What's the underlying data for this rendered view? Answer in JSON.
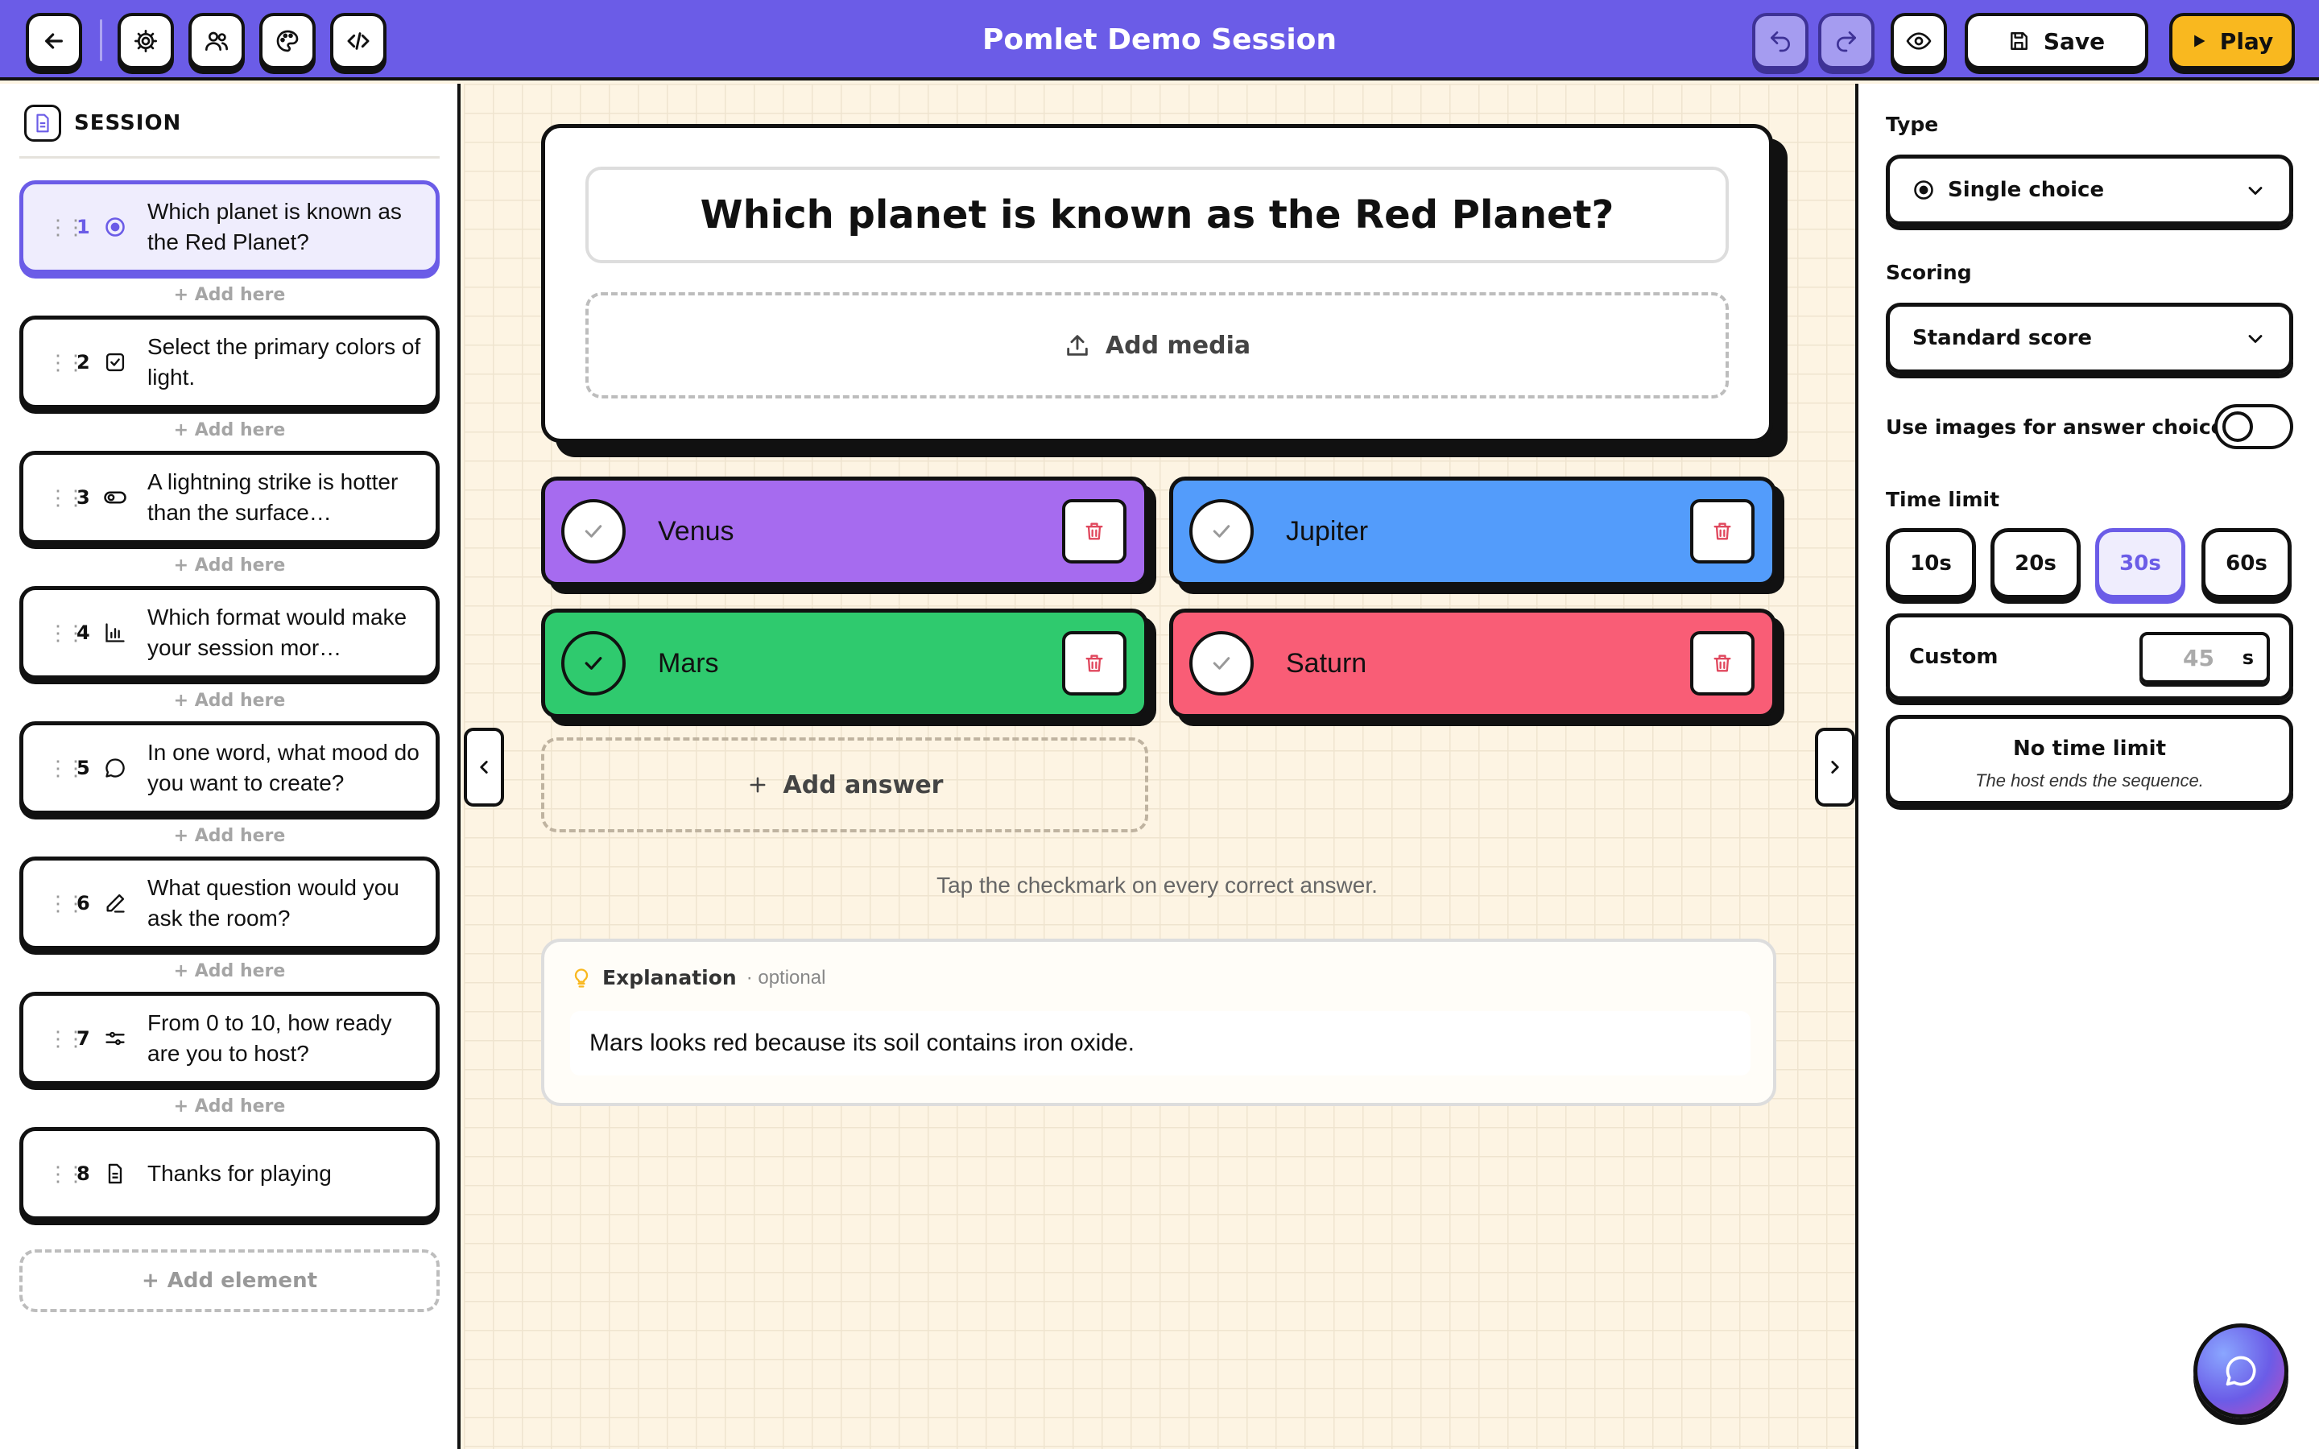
{
  "header": {
    "title": "Pomlet Demo Session",
    "save_label": "Save",
    "play_label": "Play"
  },
  "sidebar": {
    "heading": "SESSION",
    "add_here_label": "+ Add here",
    "add_element_label": "Add element",
    "items": [
      {
        "num": "1",
        "text": "Which planet is known as the Red Planet?",
        "icon": "single-choice-icon"
      },
      {
        "num": "2",
        "text": "Select the primary colors of light.",
        "icon": "multiple-choice-icon"
      },
      {
        "num": "3",
        "text": "A lightning strike is hotter than the surface…",
        "icon": "true-false-toggle-icon"
      },
      {
        "num": "4",
        "text": "Which format would make your session mor…",
        "icon": "poll-chart-icon"
      },
      {
        "num": "5",
        "text": "In one word, what mood do you want to create?",
        "icon": "word-cloud-bubble-icon"
      },
      {
        "num": "6",
        "text": "What question would you ask the room?",
        "icon": "open-text-pen-icon"
      },
      {
        "num": "7",
        "text": "From 0 to 10, how ready are you to host?",
        "icon": "scale-slider-icon"
      },
      {
        "num": "8",
        "text": "Thanks for playing",
        "icon": "slide-document-icon"
      }
    ]
  },
  "editor": {
    "question": "Which planet is known as the Red Planet?",
    "add_media_label": "Add media",
    "answers": [
      {
        "label": "Venus",
        "color": "#a66bef",
        "correct": false
      },
      {
        "label": "Jupiter",
        "color": "#539cfb",
        "correct": false
      },
      {
        "label": "Mars",
        "color": "#2fca6e",
        "correct": true
      },
      {
        "label": "Saturn",
        "color": "#f95d76",
        "correct": false
      }
    ],
    "add_answer_label": "Add answer",
    "hint": "Tap the checkmark on every correct answer.",
    "explanation": {
      "label": "Explanation",
      "optional": "· optional",
      "text": "Mars looks red because its soil contains iron oxide."
    }
  },
  "settings": {
    "type_label": "Type",
    "type_value": "Single choice",
    "scoring_label": "Scoring",
    "scoring_value": "Standard score",
    "images_label": "Use images for answer choices",
    "images_enabled": false,
    "time_limit_label": "Time limit",
    "time_options": [
      "10s",
      "20s",
      "30s",
      "60s"
    ],
    "selected_time": "30s",
    "custom_label": "Custom",
    "custom_placeholder": "45",
    "custom_unit": "s",
    "no_limit_title": "No time limit",
    "no_limit_desc": "The host ends the sequence."
  },
  "colors": {
    "accent": "#6b5ce7",
    "play": "#f9b81f",
    "canvas": "#fdf4e3"
  }
}
